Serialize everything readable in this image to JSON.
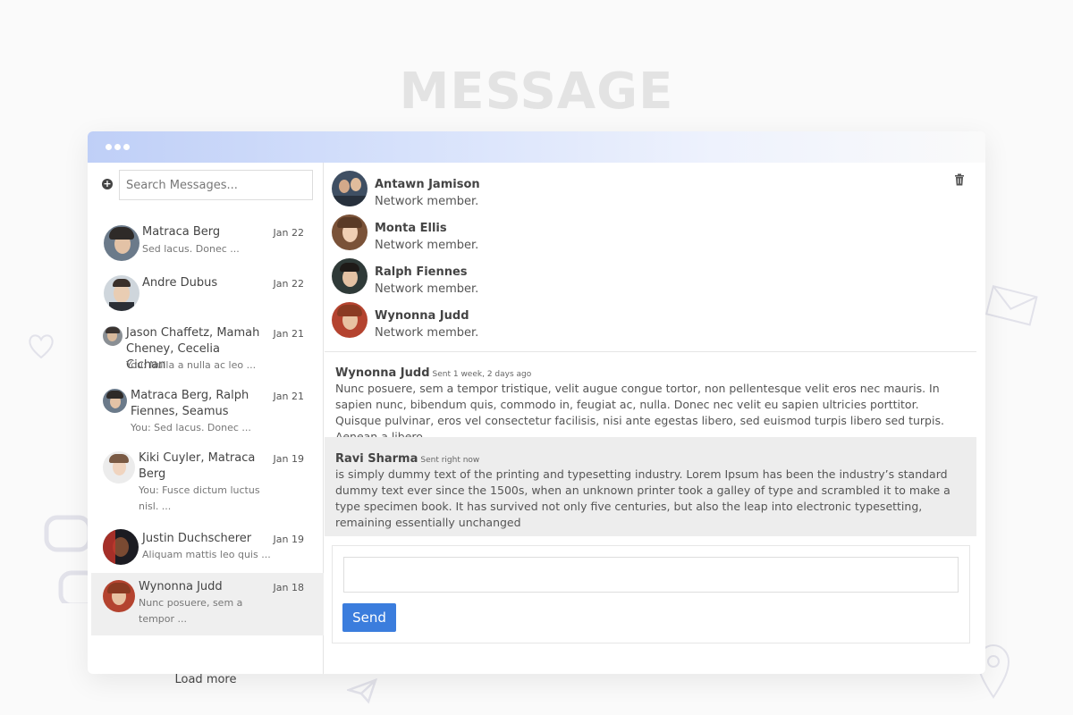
{
  "page_title": "MESSAGE",
  "search": {
    "placeholder": "Search Messages..."
  },
  "conversations": [
    {
      "name": "Matraca Berg",
      "date": "Jan 22",
      "preview": "Sed lacus. Donec ..."
    },
    {
      "name": "Andre Dubus",
      "date": "Jan 22",
      "preview": ""
    },
    {
      "name": "Jason Chaffetz, Mamah Cheney, Cecelia Cichan",
      "date": "Jan 21",
      "preview": "You: Nulla a nulla ac leo ..."
    },
    {
      "name": "Matraca Berg, Ralph Fiennes, Seamus",
      "date": "Jan 21",
      "preview": "You: Sed lacus. Donec ..."
    },
    {
      "name": "Kiki Cuyler, Matraca Berg",
      "date": "Jan 19",
      "preview": "You: Fusce dictum luctus nisl. ..."
    },
    {
      "name": "Justin Duchscherer",
      "date": "Jan 19",
      "preview": "Aliquam mattis leo quis ..."
    },
    {
      "name": "Wynonna Judd",
      "date": "Jan 18",
      "preview": "Nunc posuere, sem a tempor ..."
    }
  ],
  "load_more": "Load more",
  "participants": [
    {
      "name": "Antawn Jamison",
      "role": "Network member."
    },
    {
      "name": "Monta Ellis",
      "role": "Network member."
    },
    {
      "name": "Ralph Fiennes",
      "role": "Network member."
    },
    {
      "name": "Wynonna Judd",
      "role": "Network member."
    }
  ],
  "messages": [
    {
      "author": "Wynonna Judd",
      "meta": "Sent 1 week, 2 days ago",
      "body": "Nunc posuere, sem a tempor tristique, velit augue congue tortor, non pellentesque velit eros nec mauris. In sapien nunc, bibendum quis, commodo in, feugiat ac, nulla. Donec nec velit eu sapien ultricies porttitor. Quisque pulvinar, eros vel consectetur facilisis, nisi ante egestas libero, sed euismod turpis libero sed turpis. Aenean a libero."
    },
    {
      "author": "Ravi Sharma",
      "meta": "Sent right now",
      "body": "is simply dummy text of the printing and typesetting industry. Lorem Ipsum has been the industry’s standard dummy text ever since the 1500s, when an unknown printer took a galley of type and scrambled it to make a type specimen book. It has survived not only five centuries, but also the leap into electronic typesetting, remaining essentially unchanged"
    }
  ],
  "composer": {
    "send_label": "Send"
  },
  "colors": {
    "accent": "#3b7ddd",
    "active_row": "#efefef",
    "titlebar_start": "#bfcff7"
  },
  "icons": [
    "plus-circle-icon",
    "trash-icon",
    "heart-icon",
    "envelope-icon",
    "chat-bubble-icon",
    "paper-plane-icon",
    "map-pin-icon"
  ]
}
